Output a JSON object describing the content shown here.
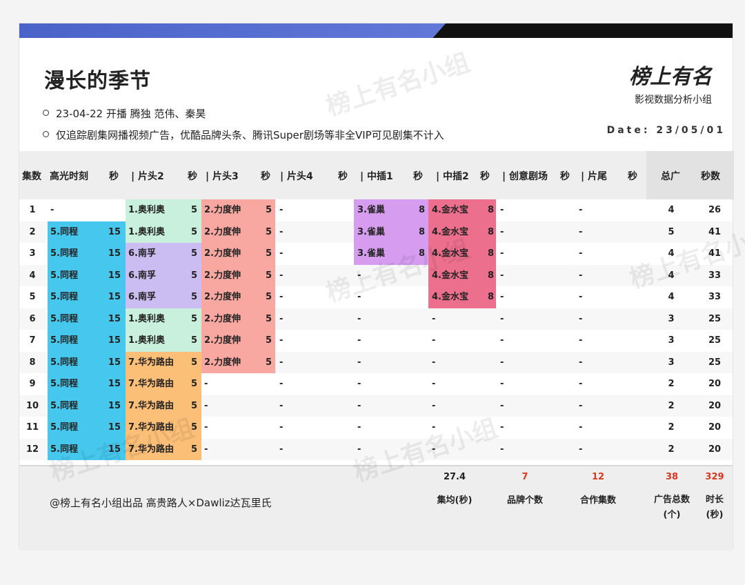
{
  "title": "漫长的季节",
  "bullets": [
    "23-04-22 开播 腾独 范伟、秦昊",
    "仅追踪剧集网播视频广告，优酷品牌头条、腾讯Super剧场等非全VIP可见剧集不计入"
  ],
  "logo": {
    "mark": "榜上有名",
    "sub": "影视数据分析小组"
  },
  "date": "Date:  23/05/01",
  "headers": {
    "ep": "集数",
    "highlight": "高光时刻",
    "sec": "秒",
    "head2": "| 片头2",
    "head3": "| 片头3",
    "head4": "| 片头4",
    "mid1": "| 中插1",
    "mid2": "| 中插2",
    "creative": "| 创意剧场",
    "tail": "| 片尾",
    "total": "总广",
    "seconds": "秒数"
  },
  "rows": [
    {
      "ep": "1",
      "hl": "-",
      "hls": "",
      "h2": "1.奥利奥",
      "h2s": "5",
      "h3": "2.力度伸",
      "h3s": "5",
      "h4": "-",
      "m1": "3.雀巢",
      "m1s": "8",
      "m2": "4.金水宝",
      "m2s": "8",
      "cr": "-",
      "tl": "-",
      "total": "4",
      "secs": "26"
    },
    {
      "ep": "2",
      "hl": "5.同程",
      "hls": "15",
      "h2": "1.奥利奥",
      "h2s": "5",
      "h3": "2.力度伸",
      "h3s": "5",
      "h4": "-",
      "m1": "3.雀巢",
      "m1s": "8",
      "m2": "4.金水宝",
      "m2s": "8",
      "cr": "-",
      "tl": "-",
      "total": "5",
      "secs": "41"
    },
    {
      "ep": "3",
      "hl": "5.同程",
      "hls": "15",
      "h2": "6.南孚",
      "h2s": "5",
      "h3": "2.力度伸",
      "h3s": "5",
      "h4": "-",
      "m1": "3.雀巢",
      "m1s": "8",
      "m2": "4.金水宝",
      "m2s": "8",
      "cr": "-",
      "tl": "-",
      "total": "4",
      "secs": "41"
    },
    {
      "ep": "4",
      "hl": "5.同程",
      "hls": "15",
      "h2": "6.南孚",
      "h2s": "5",
      "h3": "2.力度伸",
      "h3s": "5",
      "h4": "-",
      "m1": "-",
      "m1s": "",
      "m2": "4.金水宝",
      "m2s": "8",
      "cr": "-",
      "tl": "-",
      "total": "4",
      "secs": "33"
    },
    {
      "ep": "5",
      "hl": "5.同程",
      "hls": "15",
      "h2": "6.南孚",
      "h2s": "5",
      "h3": "2.力度伸",
      "h3s": "5",
      "h4": "-",
      "m1": "-",
      "m1s": "",
      "m2": "4.金水宝",
      "m2s": "8",
      "cr": "-",
      "tl": "-",
      "total": "4",
      "secs": "33"
    },
    {
      "ep": "6",
      "hl": "5.同程",
      "hls": "15",
      "h2": "1.奥利奥",
      "h2s": "5",
      "h3": "2.力度伸",
      "h3s": "5",
      "h4": "-",
      "m1": "-",
      "m1s": "",
      "m2": "-",
      "m2s": "",
      "cr": "-",
      "tl": "-",
      "total": "3",
      "secs": "25"
    },
    {
      "ep": "7",
      "hl": "5.同程",
      "hls": "15",
      "h2": "1.奥利奥",
      "h2s": "5",
      "h3": "2.力度伸",
      "h3s": "5",
      "h4": "-",
      "m1": "-",
      "m1s": "",
      "m2": "-",
      "m2s": "",
      "cr": "-",
      "tl": "-",
      "total": "3",
      "secs": "25"
    },
    {
      "ep": "8",
      "hl": "5.同程",
      "hls": "15",
      "h2": "7.华为路由",
      "h2s": "5",
      "h3": "2.力度伸",
      "h3s": "5",
      "h4": "-",
      "m1": "-",
      "m1s": "",
      "m2": "-",
      "m2s": "",
      "cr": "-",
      "tl": "-",
      "total": "3",
      "secs": "25"
    },
    {
      "ep": "9",
      "hl": "5.同程",
      "hls": "15",
      "h2": "7.华为路由",
      "h2s": "5",
      "h3": "-",
      "h3s": "",
      "h4": "-",
      "m1": "-",
      "m1s": "",
      "m2": "-",
      "m2s": "",
      "cr": "-",
      "tl": "-",
      "total": "2",
      "secs": "20"
    },
    {
      "ep": "10",
      "hl": "5.同程",
      "hls": "15",
      "h2": "7.华为路由",
      "h2s": "5",
      "h3": "-",
      "h3s": "",
      "h4": "-",
      "m1": "-",
      "m1s": "",
      "m2": "-",
      "m2s": "",
      "cr": "-",
      "tl": "-",
      "total": "2",
      "secs": "20"
    },
    {
      "ep": "11",
      "hl": "5.同程",
      "hls": "15",
      "h2": "7.华为路由",
      "h2s": "5",
      "h3": "-",
      "h3s": "",
      "h4": "-",
      "m1": "-",
      "m1s": "",
      "m2": "-",
      "m2s": "",
      "cr": "-",
      "tl": "-",
      "total": "2",
      "secs": "20"
    },
    {
      "ep": "12",
      "hl": "5.同程",
      "hls": "15",
      "h2": "7.华为路由",
      "h2s": "5",
      "h3": "-",
      "h3s": "",
      "h4": "-",
      "m1": "-",
      "m1s": "",
      "m2": "-",
      "m2s": "",
      "cr": "-",
      "tl": "-",
      "total": "2",
      "secs": "20"
    }
  ],
  "colors": {
    "tongcheng": "#46c8ee",
    "oreo": "#c8f0dc",
    "nanfu": "#cbbcf2",
    "huawei": "#fbbf78",
    "lidushen": "#f8a8a0",
    "quechao": "#d59cef",
    "jinshuibao": "#ec6f8e"
  },
  "footer": {
    "credit": "@榜上有名小组出品 高贵路人×Dawliz达瓦里氏",
    "avg_value": "27.4",
    "avg_label": "集均(秒)",
    "brands_value": "7",
    "brands_label": "品牌个数",
    "coop_value": "12",
    "coop_label": "合作集数",
    "ads_value": "38",
    "ads_label": "广告总数(个)",
    "dur_value": "329",
    "dur_label": "时长(秒)"
  },
  "watermark": "榜上有名小组"
}
